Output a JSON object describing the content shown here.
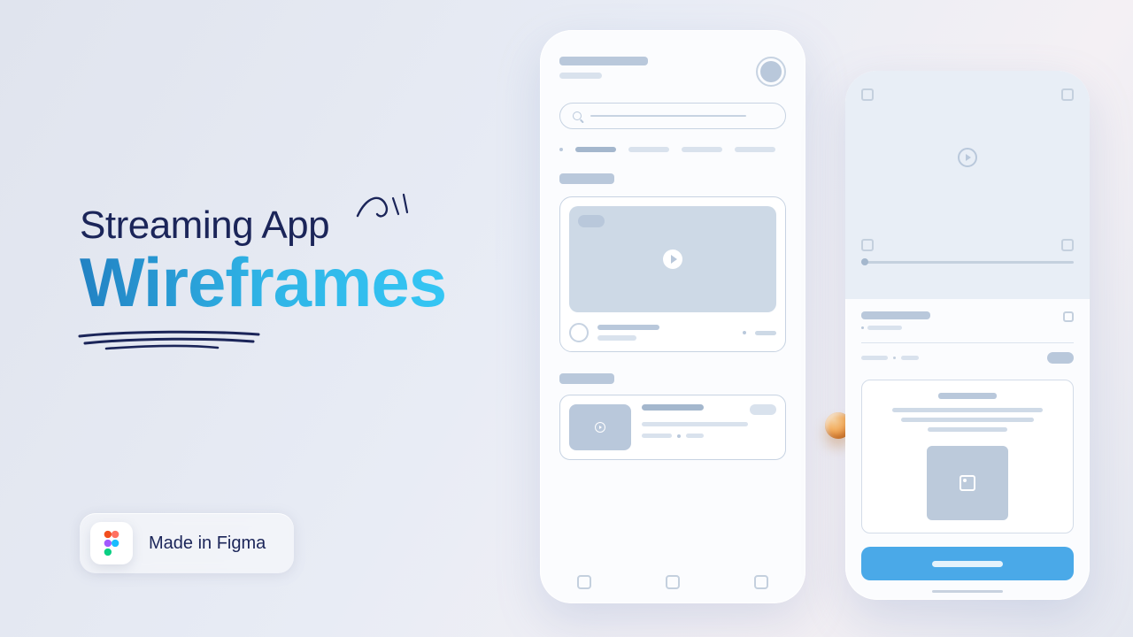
{
  "headline": {
    "line1": "Streaming App",
    "line2": "Wireframes"
  },
  "badge": {
    "label": "Made in Figma",
    "icon_name": "figma-icon"
  },
  "colors": {
    "accent_gradient_from": "#2282c3",
    "accent_gradient_to": "#34c6f4",
    "cta_button": "#4aa9e8"
  }
}
